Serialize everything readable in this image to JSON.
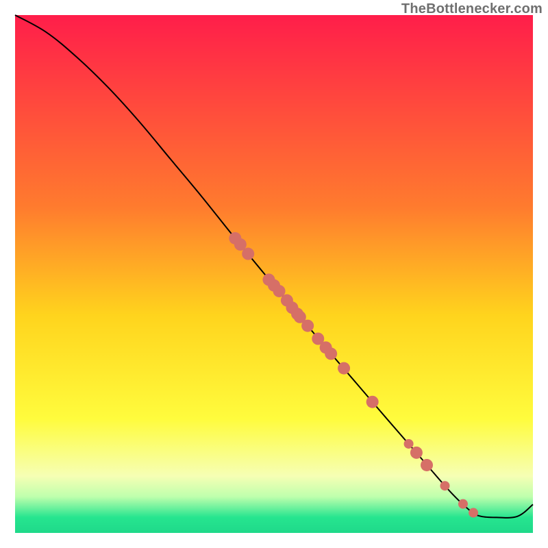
{
  "attribution": "TheBottlenecker.com",
  "chart_data": {
    "type": "line",
    "title": "",
    "xlabel": "",
    "ylabel": "",
    "xlim": [
      0,
      100
    ],
    "ylim": [
      0,
      100
    ],
    "background_gradient": {
      "stops": [
        {
          "offset": 0,
          "color": "#ff1e4a"
        },
        {
          "offset": 37,
          "color": "#ff7b2e"
        },
        {
          "offset": 58,
          "color": "#ffd41d"
        },
        {
          "offset": 78,
          "color": "#fffc3d"
        },
        {
          "offset": 89,
          "color": "#f6ffb4"
        },
        {
          "offset": 93,
          "color": "#bfffad"
        },
        {
          "offset": 97,
          "color": "#26e58f"
        },
        {
          "offset": 100,
          "color": "#1fd98a"
        }
      ]
    },
    "curve": [
      {
        "x": 0,
        "y": 100
      },
      {
        "x": 6,
        "y": 96.7
      },
      {
        "x": 12,
        "y": 91.8
      },
      {
        "x": 18,
        "y": 86.0
      },
      {
        "x": 24,
        "y": 79.4
      },
      {
        "x": 30,
        "y": 72.2
      },
      {
        "x": 36,
        "y": 65.0
      },
      {
        "x": 42,
        "y": 57.5
      },
      {
        "x": 48,
        "y": 50.2
      },
      {
        "x": 54,
        "y": 43.0
      },
      {
        "x": 60,
        "y": 35.8
      },
      {
        "x": 66,
        "y": 28.8
      },
      {
        "x": 72,
        "y": 21.8
      },
      {
        "x": 78,
        "y": 14.9
      },
      {
        "x": 84,
        "y": 8.0
      },
      {
        "x": 88,
        "y": 4.2
      },
      {
        "x": 90,
        "y": 3.2
      },
      {
        "x": 93,
        "y": 3.0
      },
      {
        "x": 97,
        "y": 3.2
      },
      {
        "x": 100,
        "y": 5.5
      }
    ],
    "points": [
      {
        "x": 42.5,
        "y": 56.9
      },
      {
        "x": 43.5,
        "y": 55.7
      },
      {
        "x": 45.0,
        "y": 53.9
      },
      {
        "x": 49.0,
        "y": 48.9
      },
      {
        "x": 50.0,
        "y": 47.8
      },
      {
        "x": 51.0,
        "y": 46.7
      },
      {
        "x": 52.5,
        "y": 44.9
      },
      {
        "x": 53.5,
        "y": 43.5
      },
      {
        "x": 54.5,
        "y": 42.3
      },
      {
        "x": 55.0,
        "y": 41.7
      },
      {
        "x": 56.5,
        "y": 40.0
      },
      {
        "x": 58.5,
        "y": 37.5
      },
      {
        "x": 60.0,
        "y": 35.8
      },
      {
        "x": 61.0,
        "y": 34.6
      },
      {
        "x": 63.5,
        "y": 31.8
      },
      {
        "x": 69.0,
        "y": 25.3
      },
      {
        "x": 76.0,
        "y": 17.2
      },
      {
        "x": 77.5,
        "y": 15.5
      },
      {
        "x": 79.5,
        "y": 13.1
      },
      {
        "x": 83.0,
        "y": 9.1
      },
      {
        "x": 86.5,
        "y": 5.6
      },
      {
        "x": 88.5,
        "y": 3.9
      }
    ],
    "style": {
      "point_color": "#d66f67",
      "point_radius_major": 9,
      "point_radius_minor": 7,
      "line_color": "#000000",
      "line_width": 2
    }
  }
}
